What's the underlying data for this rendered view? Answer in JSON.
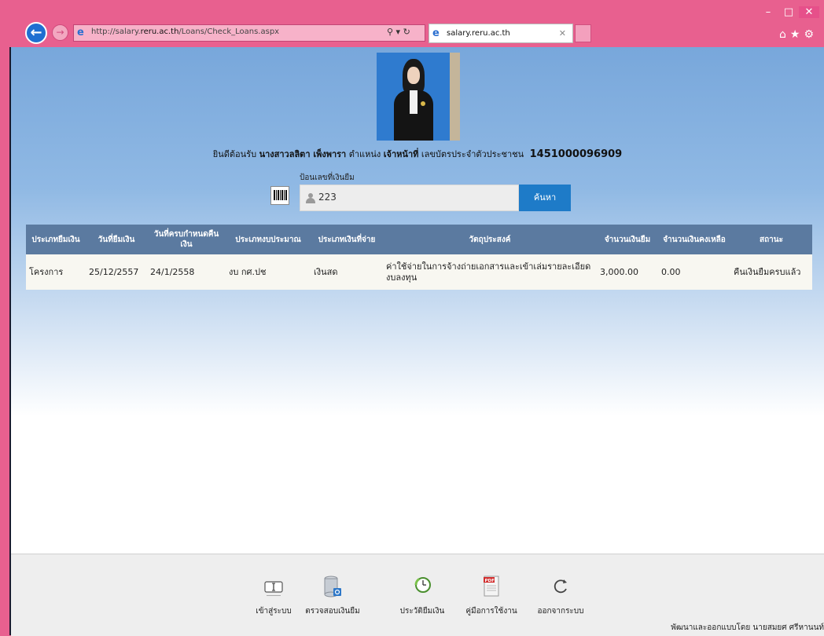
{
  "browser": {
    "url_prefix": "http://salary.",
    "url_domain": "reru.ac.th",
    "url_path": "/Loans/Check_Loans.aspx",
    "tab_title": "salary.reru.ac.th"
  },
  "welcome": {
    "greeting": "ยินดีต้อนรับ",
    "name": "นางสาวลลิตา เพ็งพารา",
    "position_label": "ตำแหน่ง",
    "position": "เจ้าหน้าที่",
    "id_label": "เลขบัตรประจำตัวประชาชน",
    "id_number": "1451000096909"
  },
  "search": {
    "label": "ป้อนเลขที่เงินยืม",
    "value": "223",
    "button": "ค้นหา"
  },
  "table": {
    "headers": [
      "ประเภทยืมเงิน",
      "วันที่ยืมเงิน",
      "วันที่ครบกำหนดคืนเงิน",
      "ประเภทงบประมาณ",
      "ประเภทเงินที่จ่าย",
      "วัตถุประสงค์",
      "จำนวนเงินยืม",
      "จำนวนเงินคงเหลือ",
      "สถานะ"
    ],
    "rows": [
      [
        "โครงการ",
        "25/12/2557",
        "24/1/2558",
        "งบ กศ.ปช",
        "เงินสด",
        "ค่าใช้จ่ายในการจ้างถ่ายเอกสารและเข้าเล่มรายละเอียดงบลงทุน",
        "3,000.00",
        "0.00",
        "คืนเงินยืมครบแล้ว"
      ]
    ]
  },
  "footer": {
    "items": [
      {
        "label": "เข้าสู่ระบบ",
        "icon": "login-icon"
      },
      {
        "label": "ตรวจสอบเงินยืม",
        "icon": "database-search-icon"
      },
      {
        "label": "ประวัติยืมเงิน",
        "icon": "history-icon"
      },
      {
        "label": "คู่มือการใช้งาน",
        "icon": "pdf-icon"
      },
      {
        "label": "ออกจากระบบ",
        "icon": "logout-icon"
      }
    ],
    "credit": "พัฒนาและออกแบบโดย นายสมยศ ศรีหานนท์"
  }
}
